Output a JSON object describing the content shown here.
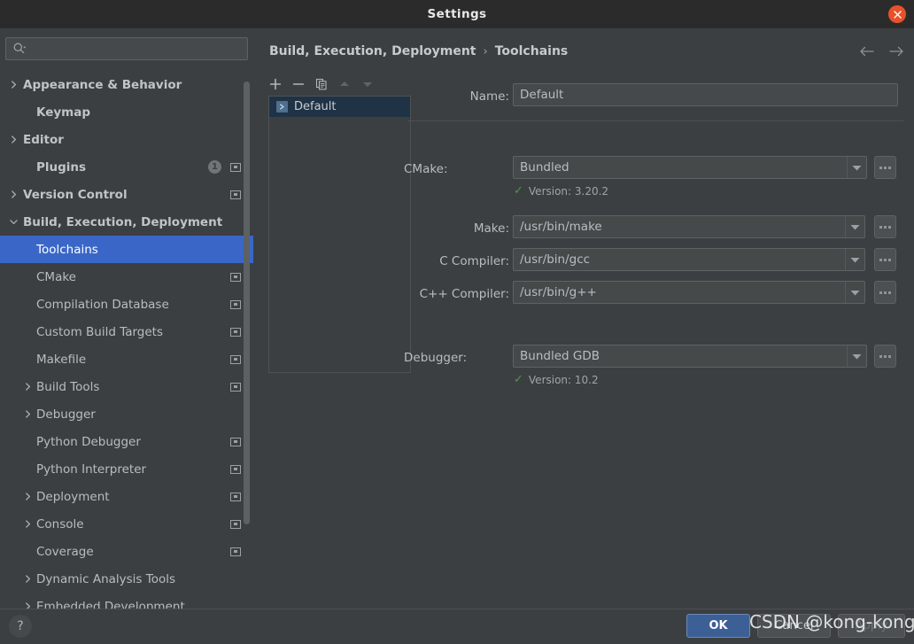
{
  "window": {
    "title": "Settings",
    "close_icon": "close-icon"
  },
  "colors": {
    "accent_selection": "#3a67c7",
    "primary_button": "#3c6096",
    "close_button": "#e8512a",
    "ok_check": "#4a9a4a",
    "background": "#3c3f41",
    "titlebar": "#2b2b2b"
  },
  "sidebar": {
    "search": {
      "placeholder": "",
      "value": "",
      "icon": "search-icon"
    },
    "items": [
      {
        "label": "Appearance & Behavior",
        "indent": 1,
        "arrow": "right",
        "bold": true,
        "selected": false,
        "badge": null,
        "modified_icon": false
      },
      {
        "label": "Keymap",
        "indent": 2,
        "arrow": "none",
        "bold": true,
        "selected": false,
        "badge": null,
        "modified_icon": false
      },
      {
        "label": "Editor",
        "indent": 1,
        "arrow": "right",
        "bold": true,
        "selected": false,
        "badge": null,
        "modified_icon": false
      },
      {
        "label": "Plugins",
        "indent": 2,
        "arrow": "none",
        "bold": true,
        "selected": false,
        "badge": "1",
        "modified_icon": true
      },
      {
        "label": "Version Control",
        "indent": 1,
        "arrow": "right",
        "bold": true,
        "selected": false,
        "badge": null,
        "modified_icon": true
      },
      {
        "label": "Build, Execution, Deployment",
        "indent": 1,
        "arrow": "down",
        "bold": true,
        "selected": false,
        "badge": null,
        "modified_icon": false
      },
      {
        "label": "Toolchains",
        "indent": 3,
        "arrow": "none",
        "bold": false,
        "selected": true,
        "badge": null,
        "modified_icon": false
      },
      {
        "label": "CMake",
        "indent": 3,
        "arrow": "none",
        "bold": false,
        "selected": false,
        "badge": null,
        "modified_icon": true
      },
      {
        "label": "Compilation Database",
        "indent": 3,
        "arrow": "none",
        "bold": false,
        "selected": false,
        "badge": null,
        "modified_icon": true
      },
      {
        "label": "Custom Build Targets",
        "indent": 3,
        "arrow": "none",
        "bold": false,
        "selected": false,
        "badge": null,
        "modified_icon": true
      },
      {
        "label": "Makefile",
        "indent": 3,
        "arrow": "none",
        "bold": false,
        "selected": false,
        "badge": null,
        "modified_icon": true
      },
      {
        "label": "Build Tools",
        "indent": 2,
        "arrow": "right",
        "bold": false,
        "selected": false,
        "badge": null,
        "modified_icon": true
      },
      {
        "label": "Debugger",
        "indent": 2,
        "arrow": "right",
        "bold": false,
        "selected": false,
        "badge": null,
        "modified_icon": false
      },
      {
        "label": "Python Debugger",
        "indent": 3,
        "arrow": "none",
        "bold": false,
        "selected": false,
        "badge": null,
        "modified_icon": true
      },
      {
        "label": "Python Interpreter",
        "indent": 3,
        "arrow": "none",
        "bold": false,
        "selected": false,
        "badge": null,
        "modified_icon": true
      },
      {
        "label": "Deployment",
        "indent": 2,
        "arrow": "right",
        "bold": false,
        "selected": false,
        "badge": null,
        "modified_icon": true
      },
      {
        "label": "Console",
        "indent": 2,
        "arrow": "right",
        "bold": false,
        "selected": false,
        "badge": null,
        "modified_icon": true
      },
      {
        "label": "Coverage",
        "indent": 3,
        "arrow": "none",
        "bold": false,
        "selected": false,
        "badge": null,
        "modified_icon": true
      },
      {
        "label": "Dynamic Analysis Tools",
        "indent": 2,
        "arrow": "right",
        "bold": false,
        "selected": false,
        "badge": null,
        "modified_icon": false
      },
      {
        "label": "Embedded Development",
        "indent": 2,
        "arrow": "right",
        "bold": false,
        "selected": false,
        "badge": null,
        "modified_icon": false
      }
    ]
  },
  "main": {
    "breadcrumb": {
      "root": "Build, Execution, Deployment",
      "separator": "›",
      "leaf": "Toolchains"
    },
    "nav": {
      "back_icon": "arrow-left-icon",
      "forward_icon": "arrow-right-icon"
    },
    "toolchain_toolbar": [
      {
        "name": "add-toolchain-button",
        "icon": "plus-icon",
        "enabled": true
      },
      {
        "name": "remove-toolchain-button",
        "icon": "minus-icon",
        "enabled": true
      },
      {
        "name": "copy-toolchain-button",
        "icon": "copy-icon",
        "enabled": true
      },
      {
        "name": "move-up-button",
        "icon": "chevron-up-icon",
        "enabled": false
      },
      {
        "name": "move-down-button",
        "icon": "chevron-down-icon",
        "enabled": false
      }
    ],
    "toolchain_list": [
      {
        "label": "Default",
        "selected": true
      }
    ],
    "form": {
      "name": {
        "label": "Name:",
        "value": "Default"
      },
      "cmake": {
        "label": "CMake:",
        "value": "Bundled",
        "version_text": "Version: 3.20.2",
        "version_ok": true,
        "browse_label": "..."
      },
      "make": {
        "label": "Make:",
        "value": "/usr/bin/make",
        "browse_label": "..."
      },
      "c_compiler": {
        "label": "C Compiler:",
        "value": "/usr/bin/gcc",
        "browse_label": "..."
      },
      "cpp_compiler": {
        "label": "C++ Compiler:",
        "value": "/usr/bin/g++",
        "browse_label": "..."
      },
      "debugger": {
        "label": "Debugger:",
        "value": "Bundled GDB",
        "version_text": "Version: 10.2",
        "version_ok": true,
        "browse_label": "..."
      }
    }
  },
  "footer": {
    "help_label": "?",
    "ok_label": "OK",
    "cancel_label": "Cancel",
    "apply_label": "Apply"
  },
  "watermark": {
    "text": "CSDN @kong-kong"
  }
}
